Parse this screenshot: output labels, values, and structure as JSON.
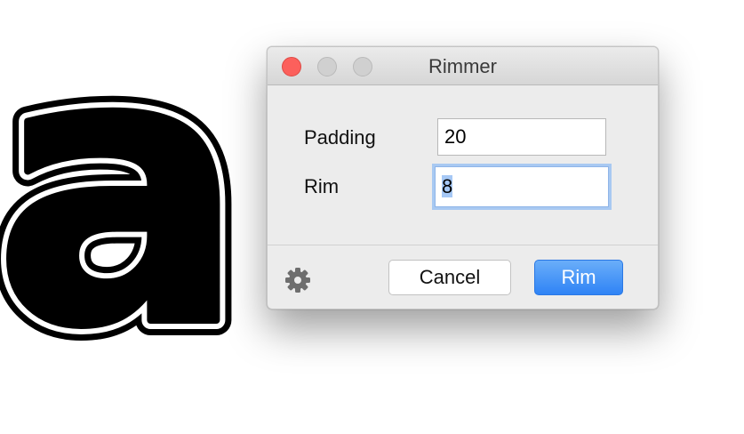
{
  "glyph": {
    "char": "a"
  },
  "window": {
    "title": "Rimmer"
  },
  "form": {
    "padding_label": "Padding",
    "padding_value": "20",
    "rim_label": "Rim",
    "rim_value": "8"
  },
  "buttons": {
    "cancel": "Cancel",
    "primary": "Rim"
  },
  "icons": {
    "close": "close-icon",
    "minimize": "minimize-icon",
    "zoom": "zoom-icon",
    "settings": "gear-icon"
  },
  "colors": {
    "close_button": "#fc605c",
    "primary_button": "#3e8ef7",
    "focus_ring": "#a8c9f2"
  }
}
